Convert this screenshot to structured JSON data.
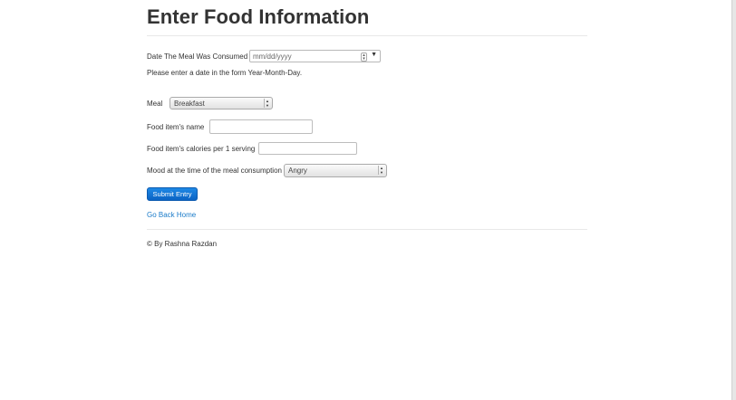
{
  "page": {
    "title": "Enter Food Information"
  },
  "form": {
    "date_label": "Date The Meal Was Consumed",
    "date_placeholder": "mm/dd/yyyy",
    "date_hint": "Please enter a date in the form Year-Month-Day.",
    "meal_label": "Meal",
    "meal_selected": "Breakfast",
    "food_name_label": "Food item's name",
    "food_name_value": "",
    "calories_label": "Food item's calories per 1 serving",
    "calories_value": "",
    "mood_label": "Mood at the time of the meal consumption",
    "mood_selected": "Angry",
    "submit_label": "Submit Entry"
  },
  "nav": {
    "back_home_label": "Go Back Home"
  },
  "footer": {
    "text": "© By Rashna Razdan"
  },
  "colors": {
    "primary_button": "#0b63c4",
    "link": "#1a7bc9"
  }
}
